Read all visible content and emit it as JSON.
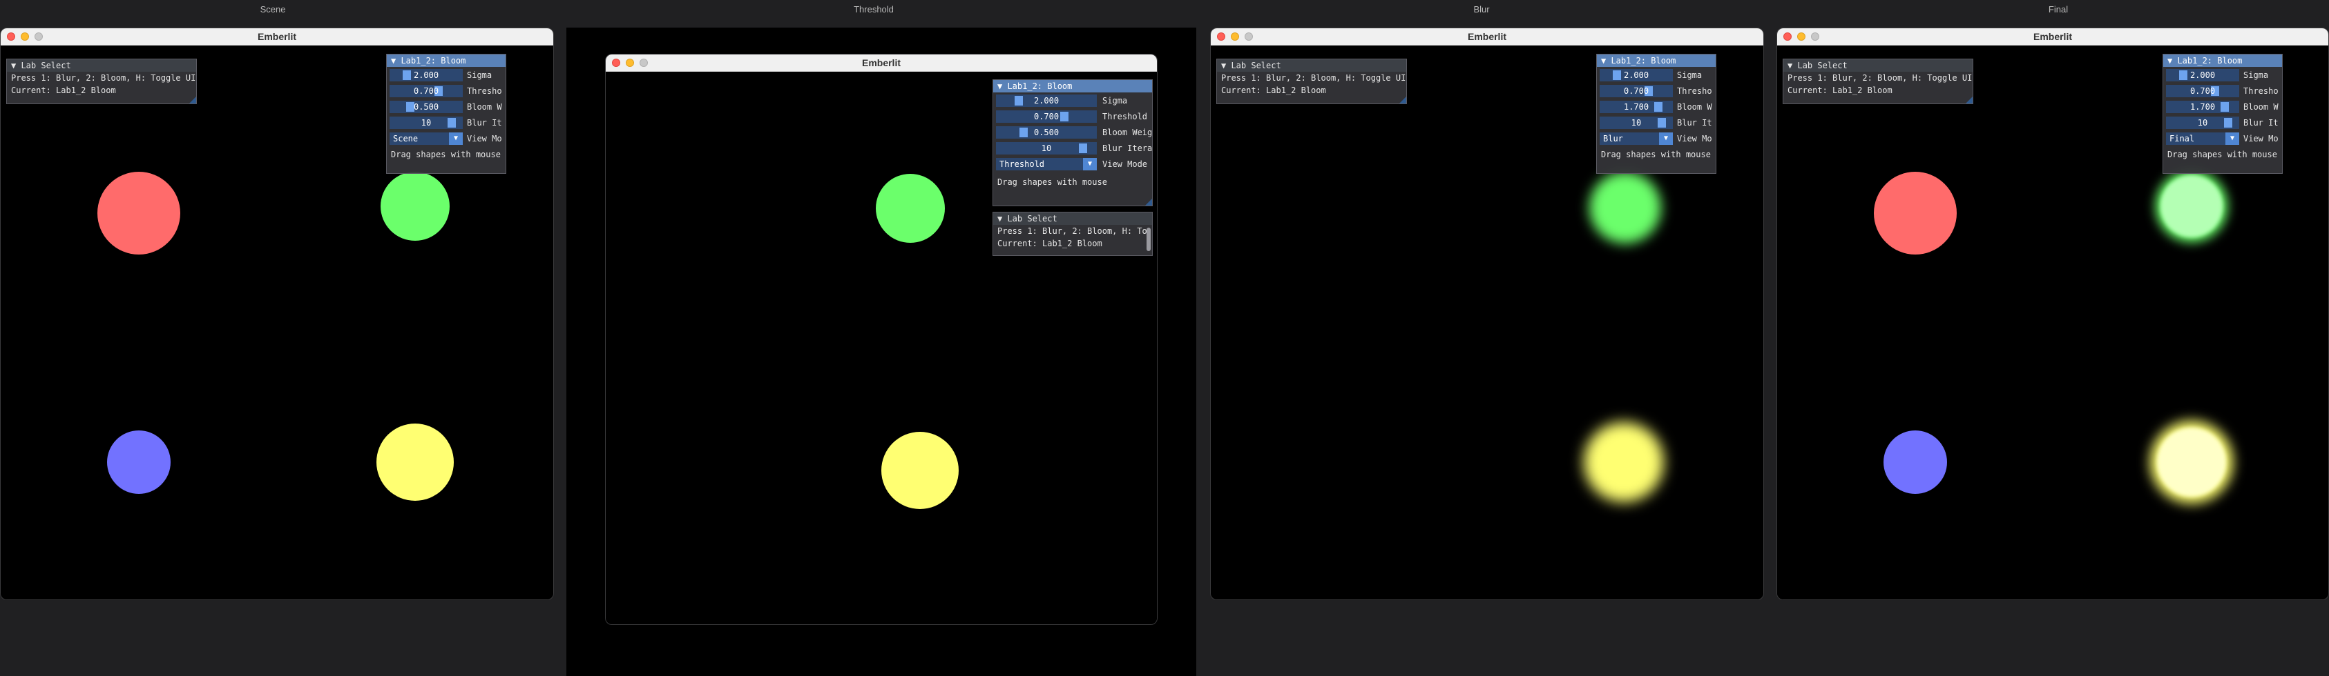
{
  "captions": [
    "Scene",
    "Threshold",
    "Blur",
    "Final"
  ],
  "window_title": "Emberlit",
  "colors": {
    "red": "#ff6b6b",
    "green": "#6bff6b",
    "blue": "#7272ff",
    "yellow": "#ffff72",
    "panel_head_active": "#5a82b8",
    "slider_grab": "#6da3ee"
  },
  "lab_select": {
    "title": "Lab Select",
    "line1": "Press 1: Blur, 2: Bloom, H: Toggle UI",
    "line1_truncated": "Press 1: Blur, 2: Bloom, H: To",
    "line2": "Current: Lab1_2 Bloom"
  },
  "bloom_panel": {
    "title": "Lab1_2: Bloom",
    "params": [
      {
        "label": "Sigma",
        "short": "Sigma",
        "value": "2.000",
        "fraction": 0.2
      },
      {
        "label": "Threshold",
        "short": "Thresho",
        "value": "0.700",
        "fraction": 0.7
      },
      {
        "label": "Bloom Weight",
        "short": "Bloom W",
        "value": "0.500",
        "fraction": 0.25
      },
      {
        "label": "Blur Iterations",
        "short": "Blur It",
        "value": "10",
        "fraction": 0.9
      }
    ],
    "params_blur": [
      {
        "value": "2.000",
        "fraction": 0.2
      },
      {
        "value": "0.700",
        "fraction": 0.7
      },
      {
        "value": "1.700",
        "fraction": 0.85
      },
      {
        "value": "10",
        "fraction": 0.9
      }
    ],
    "mid_labels": [
      "Sigma",
      "Threshold",
      "Bloom Weig",
      "Blur Itera"
    ],
    "view_mode_label": "View Mode",
    "view_mode_short": "View Mo",
    "view_modes": [
      "Scene",
      "Threshold",
      "Blur",
      "Final"
    ],
    "hint": "Drag shapes with mouse"
  }
}
